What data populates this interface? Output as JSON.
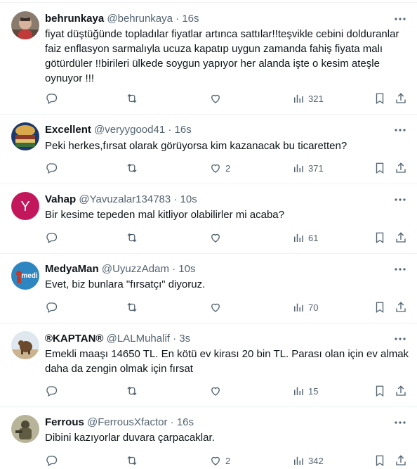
{
  "icons": {
    "reply": "reply-icon",
    "retweet": "retweet-icon",
    "like": "like-icon",
    "views": "views-icon",
    "bookmark": "bookmark-icon",
    "share": "share-icon",
    "more": "more-icon"
  },
  "colors": {
    "text": "#0f1419",
    "secondary": "#536471",
    "divider": "#eff3f4"
  },
  "tweets": [
    {
      "name": "behrunkaya",
      "handle": "@behrunkaya",
      "sep": "·",
      "time": "16s",
      "text": "fiyat düştüğünde topladılar fiyatlar artınca sattılar!!teşvikle cebini dolduranlar faiz enflasyon sarmalıyla ucuza kapatıp uygun zamanda fahiş fiyata malı götürdüler !!birileri ülkede soygun yapıyor her alanda işte o kesim ateşle oynuyor !!!",
      "replies": "",
      "retweets": "",
      "likes": "",
      "views": "321"
    },
    {
      "name": "Excellent",
      "handle": "@veryygood41",
      "sep": "·",
      "time": "16s",
      "text": "Peki herkes,fırsat olarak görüyorsa kim kazanacak bu ticaretten?",
      "replies": "",
      "retweets": "",
      "likes": "2",
      "views": "371"
    },
    {
      "name": "Vahap",
      "handle": "@Yavuzalar134783",
      "sep": "·",
      "time": "10s",
      "avatar_letter": "Y",
      "text": "Bir kesime tepeden mal kitliyor olabilirler mi acaba?",
      "replies": "",
      "retweets": "",
      "likes": "",
      "views": "61"
    },
    {
      "name": "MedyaMan",
      "handle": "@UyuzzAdam",
      "sep": "·",
      "time": "10s",
      "avatar_text": "medi",
      "text": "Evet, biz bunlara \"fırsatçı\" diyoruz.",
      "replies": "",
      "retweets": "",
      "likes": "",
      "views": "70"
    },
    {
      "name": "®KAPTAN®",
      "handle": "@LALMuhalif",
      "sep": "·",
      "time": "3s",
      "text": "Emekli maaşı 14650 TL. En kötü ev kirası 20 bin TL. Parası olan için ev almak daha da zengin olmak için fırsat",
      "replies": "",
      "retweets": "",
      "likes": "",
      "views": "15"
    },
    {
      "name": "Ferrous",
      "handle": "@FerrousXfactor",
      "sep": "·",
      "time": "16s",
      "text": "Dibini kazıyorlar duvara çarpacaklar.",
      "replies": "",
      "retweets": "",
      "likes": "2",
      "views": "342"
    }
  ]
}
